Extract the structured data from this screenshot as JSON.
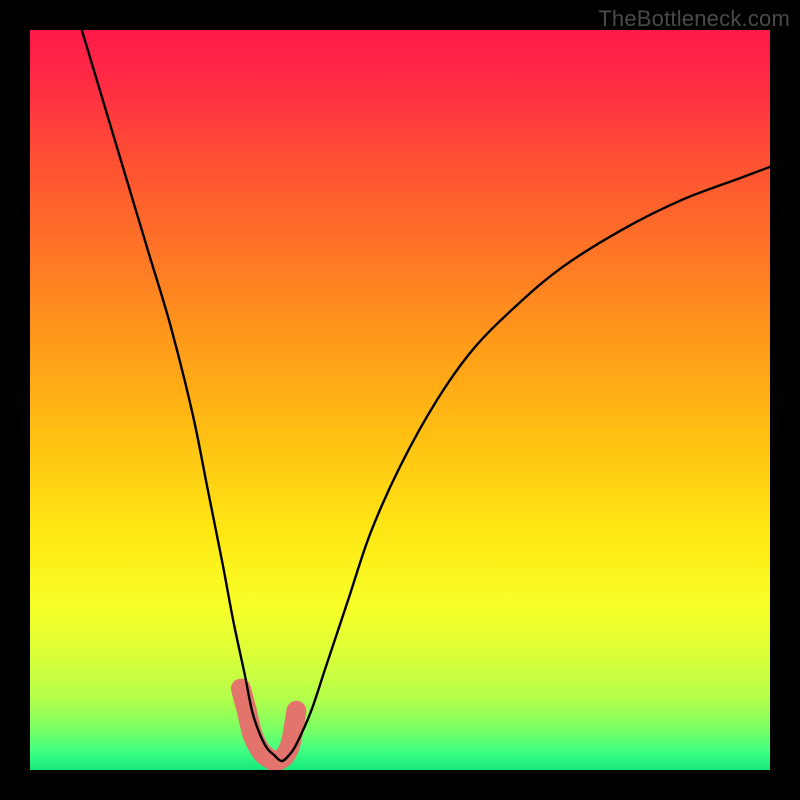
{
  "watermark": "TheBottleneck.com",
  "chart_data": {
    "type": "line",
    "title": "",
    "xlabel": "",
    "ylabel": "",
    "xlim": [
      0,
      100
    ],
    "ylim": [
      0,
      100
    ],
    "grid": false,
    "series": [
      {
        "name": "left-branch",
        "x": [
          7,
          10,
          13,
          16,
          19,
          22,
          24,
          26,
          27.5,
          29,
          30,
          31,
          32,
          33,
          34
        ],
        "y": [
          100,
          90,
          80,
          70,
          60,
          48,
          38,
          28,
          20,
          13,
          8,
          5,
          3,
          2,
          1.2
        ]
      },
      {
        "name": "right-branch",
        "x": [
          34,
          35,
          36,
          38,
          40,
          43,
          46,
          50,
          55,
          60,
          66,
          72,
          80,
          88,
          96,
          100
        ],
        "y": [
          1.2,
          2,
          3.5,
          8,
          14,
          23,
          32,
          41,
          50,
          57,
          63,
          68,
          73,
          77,
          80,
          81.5
        ]
      },
      {
        "name": "highlight-bottom",
        "x": [
          28.5,
          29.3,
          30,
          30.8,
          31.5,
          32.3,
          33,
          33.8,
          34.5,
          35.2,
          35.6,
          36
        ],
        "y": [
          11,
          8,
          5,
          3.2,
          2.2,
          1.6,
          1.2,
          1.4,
          2,
          3.5,
          5.5,
          8
        ]
      }
    ],
    "gradient_stops": [
      {
        "offset": 0.0,
        "color": "#ff1a49"
      },
      {
        "offset": 0.07,
        "color": "#ff2b44"
      },
      {
        "offset": 0.18,
        "color": "#ff5133"
      },
      {
        "offset": 0.3,
        "color": "#ff7526"
      },
      {
        "offset": 0.42,
        "color": "#ff9a1a"
      },
      {
        "offset": 0.55,
        "color": "#ffc012"
      },
      {
        "offset": 0.68,
        "color": "#ffe814"
      },
      {
        "offset": 0.78,
        "color": "#f8ff28"
      },
      {
        "offset": 0.85,
        "color": "#d8ff3a"
      },
      {
        "offset": 0.905,
        "color": "#b2ff4c"
      },
      {
        "offset": 0.945,
        "color": "#7aff63"
      },
      {
        "offset": 0.975,
        "color": "#3dff84"
      },
      {
        "offset": 1.0,
        "color": "#17e879"
      }
    ],
    "highlight_color": "#e2746c",
    "curve_color": "#000000"
  }
}
